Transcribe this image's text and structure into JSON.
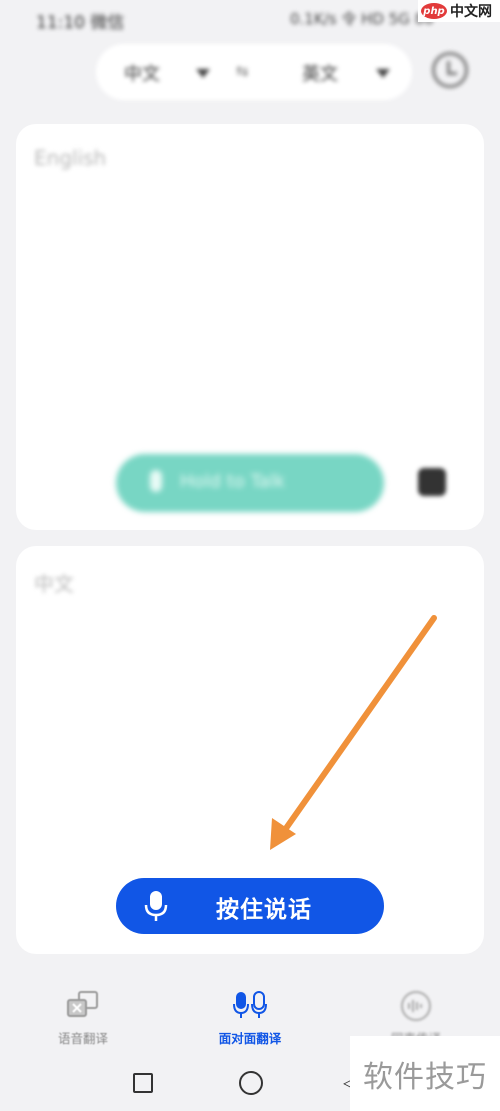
{
  "status_bar": {
    "time": "11:10 微信",
    "right": "0.1K/s 令 HD 5G 88"
  },
  "watermark_top": {
    "badge": "php",
    "text": "中文网"
  },
  "language_bar": {
    "source_lang": "中文",
    "swap": "⇆",
    "target_lang": "英文"
  },
  "top_card": {
    "hint": "English",
    "hold_button_label": "Hold to Talk"
  },
  "bottom_card": {
    "hint": "中文",
    "hold_button_label": "按住说话"
  },
  "bottom_nav": {
    "items": [
      {
        "label": "语音翻译",
        "active": false
      },
      {
        "label": "面对面翻译",
        "active": true
      },
      {
        "label": "同声传译",
        "active": false
      }
    ]
  },
  "system_nav": {
    "back": "◁"
  },
  "watermark_bottom": {
    "text": "软件技巧"
  },
  "colors": {
    "accent_blue": "#1156e6",
    "teal_button": "#78d6c4",
    "arrow_orange": "#f0913a",
    "background": "#f2f2f4"
  },
  "icons": {
    "top_right": "history-icon",
    "speaker": "speaker-icon",
    "nav_voice": "voice-translate-icon",
    "nav_face": "dual-mic-icon",
    "nav_simul": "sound-wave-icon"
  }
}
